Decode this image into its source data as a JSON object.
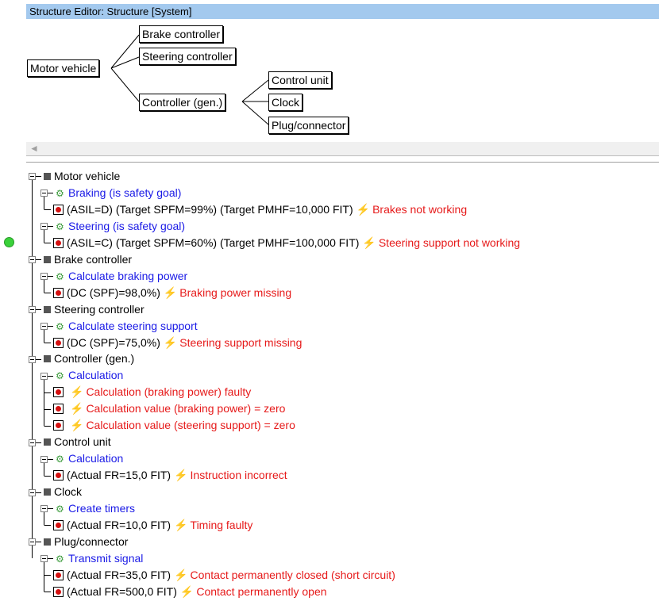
{
  "window": {
    "title": "Structure Editor: Structure [System]"
  },
  "diagram": {
    "nodes": {
      "motor_vehicle": "Motor vehicle",
      "brake_controller": "Brake controller",
      "steering_controller": "Steering controller",
      "controller_gen": "Controller (gen.)",
      "control_unit": "Control unit",
      "clock": "Clock",
      "plug_connector": "Plug/connector"
    }
  },
  "scroll": {
    "left_arrow": "◄"
  },
  "tree": {
    "motor_vehicle": {
      "label": "Motor vehicle",
      "functions": [
        {
          "label": "Braking (is safety goal)",
          "failures": [
            {
              "params": "(ASIL=D) (Target SPFM=99%) (Target PMHF=10,000 FIT)",
              "text": "Brakes not working"
            }
          ]
        },
        {
          "label": "Steering (is safety goal)",
          "failures": [
            {
              "params": "(ASIL=C) (Target SPFM=60%) (Target PMHF=100,000 FIT)",
              "text": "Steering support not working"
            }
          ]
        }
      ]
    },
    "brake_controller": {
      "label": "Brake controller",
      "functions": [
        {
          "label": "Calculate braking power",
          "failures": [
            {
              "params": "(DC (SPF)=98,0%)",
              "text": "Braking power missing"
            }
          ]
        }
      ]
    },
    "steering_controller": {
      "label": "Steering controller",
      "functions": [
        {
          "label": "Calculate steering support",
          "failures": [
            {
              "params": "(DC (SPF)=75,0%)",
              "text": "Steering support missing"
            }
          ]
        }
      ]
    },
    "controller_gen": {
      "label": "Controller (gen.)",
      "functions": [
        {
          "label": "Calculation",
          "failures": [
            {
              "params": "",
              "text": "Calculation (braking power) faulty"
            },
            {
              "params": "",
              "text": "Calculation value (braking power) = zero"
            },
            {
              "params": "",
              "text": "Calculation value (steering support) = zero"
            }
          ]
        }
      ]
    },
    "control_unit": {
      "label": "Control unit",
      "functions": [
        {
          "label": "Calculation",
          "failures": [
            {
              "params": "(Actual FR=15,0 FIT)",
              "text": "Instruction incorrect"
            }
          ]
        }
      ]
    },
    "clock": {
      "label": "Clock",
      "functions": [
        {
          "label": "Create timers",
          "failures": [
            {
              "params": "(Actual FR=10,0 FIT)",
              "text": "Timing faulty"
            }
          ]
        }
      ]
    },
    "plug_connector": {
      "label": "Plug/connector",
      "functions": [
        {
          "label": "Transmit signal",
          "failures": [
            {
              "params": "(Actual FR=35,0 FIT)",
              "text": "Contact permanently closed (short circuit)"
            },
            {
              "params": "(Actual FR=500,0 FIT)",
              "text": "Contact permanently open"
            }
          ]
        }
      ]
    }
  },
  "icons": {
    "system_element": "square-icon",
    "function": "gear-icon",
    "failure_mode": "failure-mode-icon",
    "failure": "lightning-icon",
    "status": "green-circle-icon"
  },
  "colors": {
    "function_text": "#1a1ae6",
    "failure_text": "#e61a1a",
    "titlebar": "#a3c9ee",
    "status": "#3ad13a"
  }
}
